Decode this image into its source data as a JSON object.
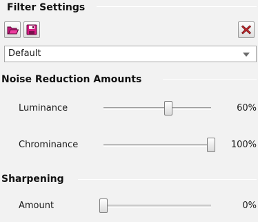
{
  "filter_settings": {
    "title": "Filter Settings",
    "open_icon": "folder-open-icon",
    "save_icon": "floppy-disk-icon",
    "close_icon": "close-x-icon",
    "preset": {
      "selected": "Default"
    }
  },
  "noise_reduction": {
    "title": "Noise Reduction Amounts",
    "luminance": {
      "label": "Luminance",
      "value_text": "60%",
      "value": 0.6
    },
    "chrominance": {
      "label": "Chrominance",
      "value_text": "100%",
      "value": 1.0
    }
  },
  "sharpening": {
    "title": "Sharpening",
    "amount": {
      "label": "Amount",
      "value_text": "0%",
      "value": 0.0
    }
  },
  "colors": {
    "icon_magenta": "#e0218a",
    "close_red": "#c0282d"
  }
}
